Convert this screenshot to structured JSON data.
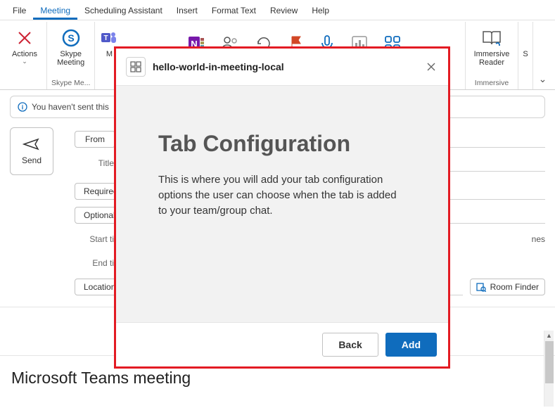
{
  "menubar": {
    "items": [
      "File",
      "Meeting",
      "Scheduling Assistant",
      "Insert",
      "Format Text",
      "Review",
      "Help"
    ],
    "active_index": 1
  },
  "ribbon": {
    "actions": {
      "label": "Actions",
      "dropdown": "⌄",
      "group_label": ""
    },
    "skype": {
      "label": "Skype Meeting",
      "group_label": "Skype Me..."
    },
    "teams_partial": "M",
    "immersive": {
      "label": "Immersive Reader",
      "group_label": "Immersive"
    },
    "right_partial": "S"
  },
  "info_bar": {
    "text": "You haven't sent this"
  },
  "send": {
    "label": "Send"
  },
  "form": {
    "from_btn": "From",
    "title_label": "Title",
    "required_btn": "Required",
    "optional_btn": "Optional",
    "start_label": "Start ti",
    "end_label": "End ti",
    "location_btn": "Location",
    "timezone_suffix": "nes",
    "room_finder": "Room Finder"
  },
  "body": {
    "title": "Microsoft Teams meeting"
  },
  "modal": {
    "app_title": "hello-world-in-meeting-local",
    "heading": "Tab Configuration",
    "description": "This is where you will add your tab configuration options the user can choose when the tab is added to your team/group chat.",
    "back": "Back",
    "add": "Add"
  }
}
